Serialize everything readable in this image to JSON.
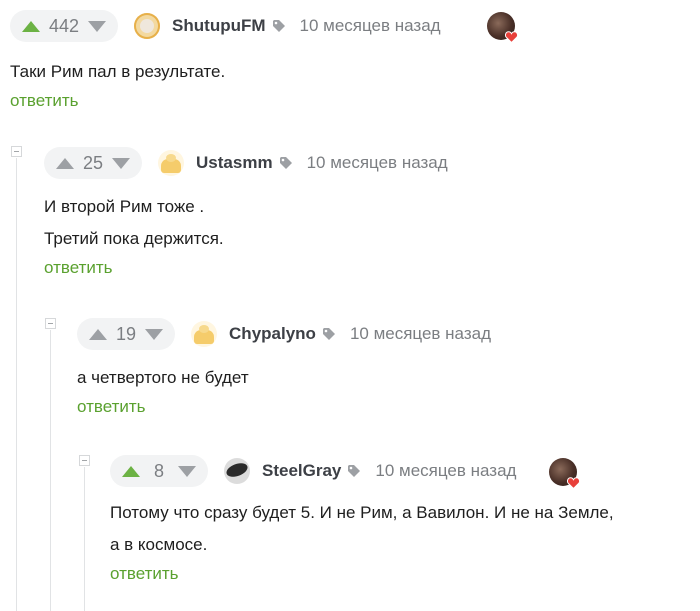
{
  "colors": {
    "upvote_active": "#6cb244",
    "reply_link": "#5aa12f",
    "muted": "#7b7e82",
    "heart": "#e8403a"
  },
  "comments": [
    {
      "rating": "442",
      "nick": "ShutupuFM",
      "time": "10 месяцев назад",
      "lines": [
        "Таки Рим пал в результате."
      ],
      "reply": "ответить"
    },
    {
      "rating": "25",
      "nick": "Ustasmm",
      "time": "10 месяцев назад",
      "lines": [
        "И второй Рим тоже .",
        "Третий пока держится."
      ],
      "reply": "ответить"
    },
    {
      "rating": "19",
      "nick": "Chypalyno",
      "time": "10 месяцев назад",
      "lines": [
        "а четвертого не будет"
      ],
      "reply": "ответить"
    },
    {
      "rating": "8",
      "nick": "SteelGray",
      "time": "10 месяцев назад",
      "lines": [
        "Потому что сразу будет 5. И не Рим, а Вавилон. И не на Земле,",
        "а в космосе."
      ],
      "reply": "ответить"
    }
  ]
}
